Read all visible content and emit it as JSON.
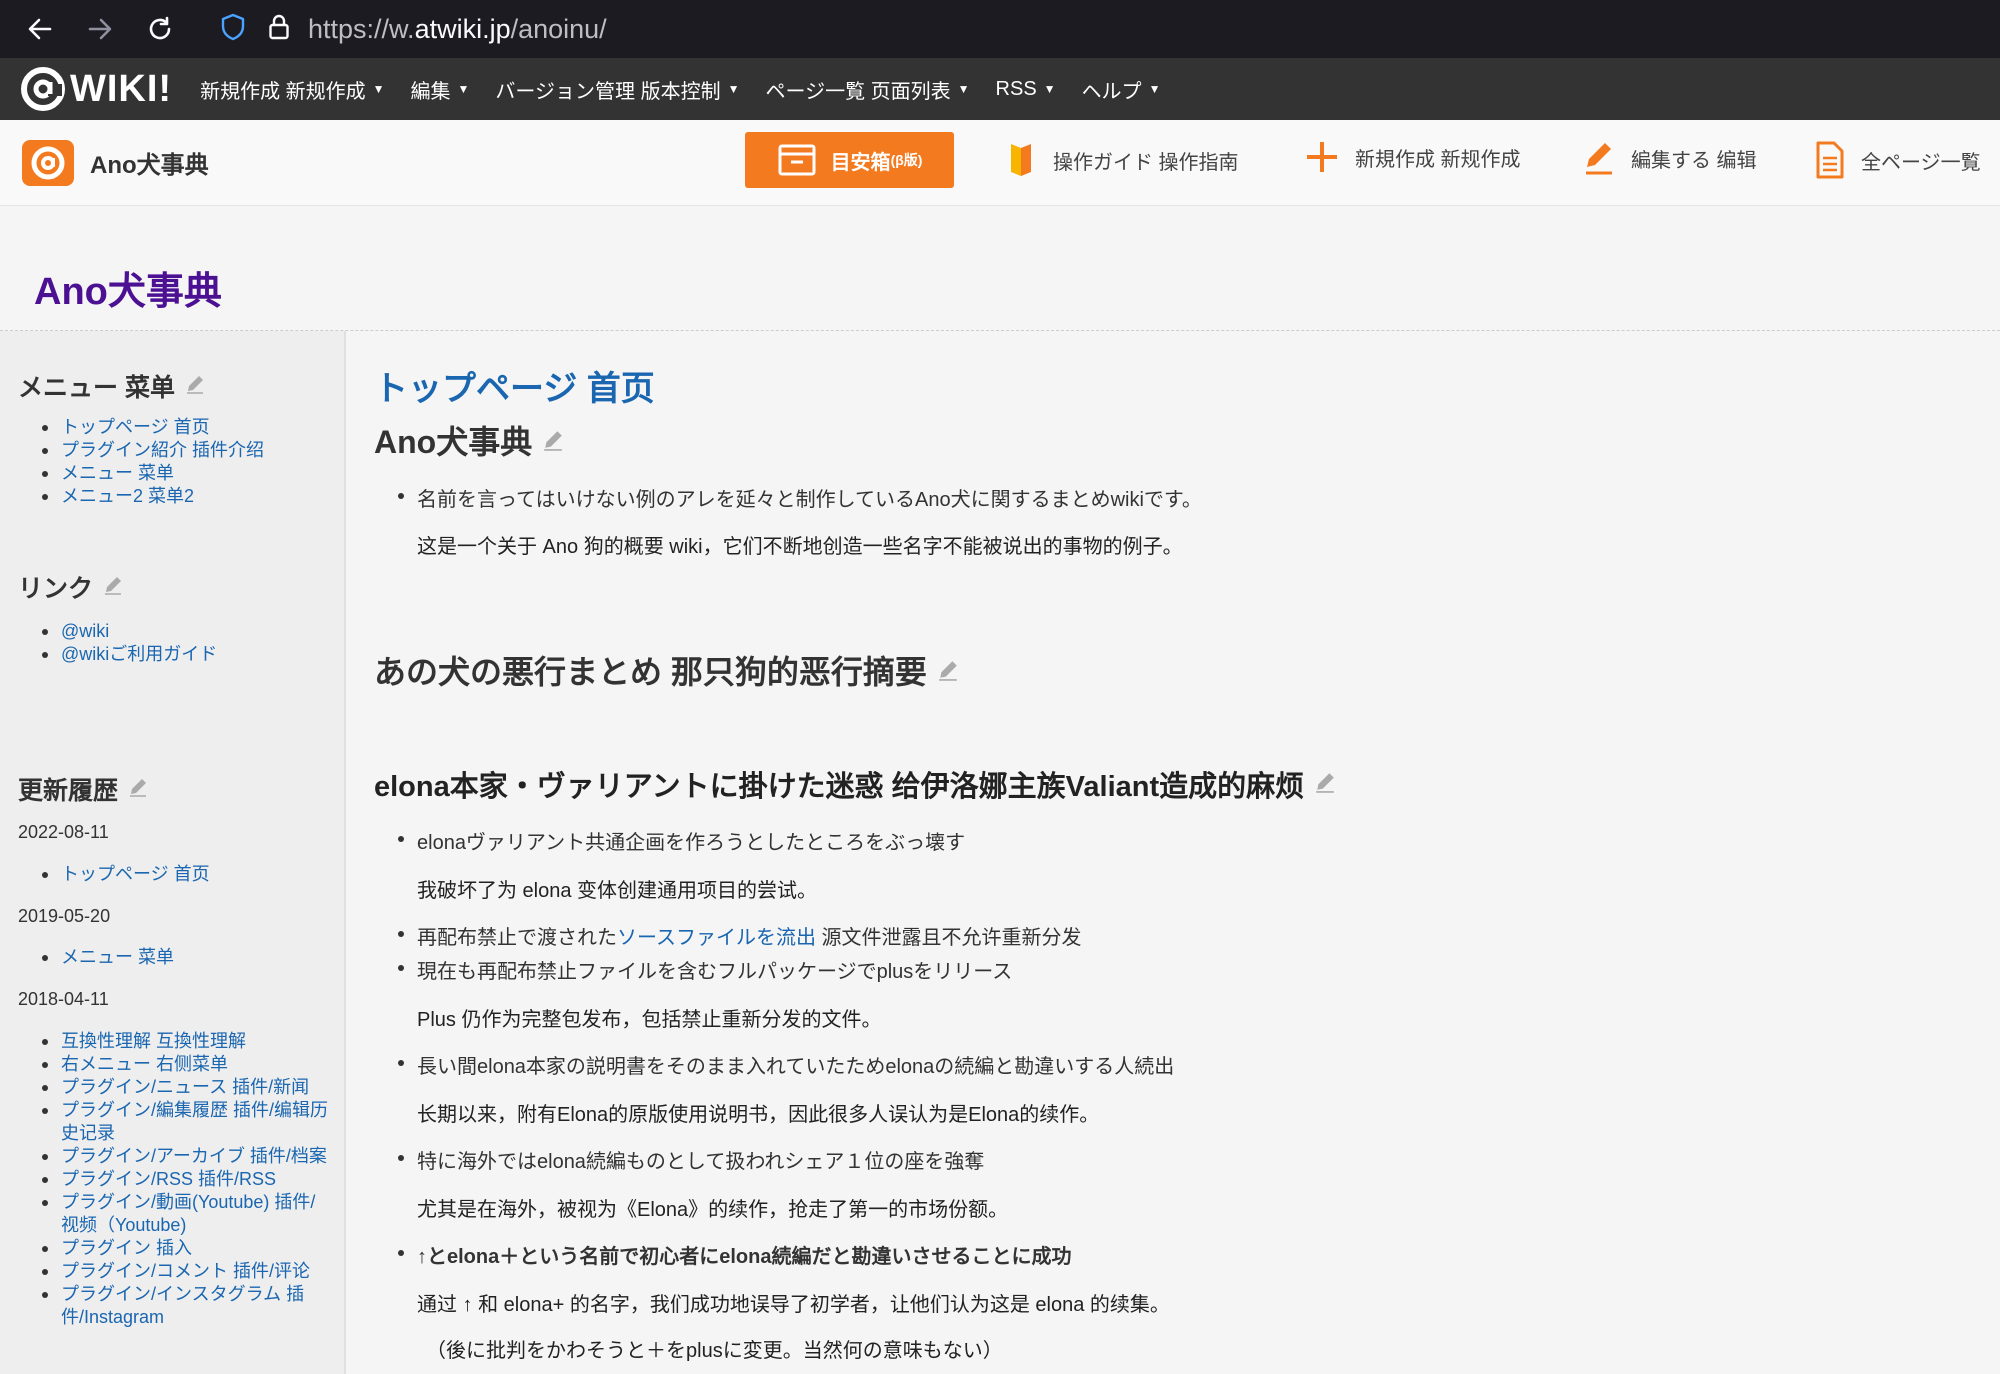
{
  "browser": {
    "url_prefix": "https://w.",
    "url_domain": "atwiki.jp",
    "url_path": "/anoinu/"
  },
  "menubar": {
    "logo": "WIKI!",
    "items": [
      {
        "label": "新規作成 新规作成"
      },
      {
        "label": "編集"
      },
      {
        "label": "バージョン管理 版本控制"
      },
      {
        "label": "ページ一覧 页面列表"
      },
      {
        "label": "RSS"
      },
      {
        "label": "ヘルプ"
      }
    ]
  },
  "header": {
    "site_name": "Ano犬事典",
    "promo_label": "目安箱",
    "promo_small": "(β版)",
    "links": [
      {
        "label": "操作ガイド 操作指南",
        "icon": "guide-icon"
      },
      {
        "label": "新規作成 新规作成",
        "icon": "plus-icon"
      },
      {
        "label": "編集する 编辑",
        "icon": "pencil-icon"
      },
      {
        "label": "全ページ一覧",
        "icon": "page-list-icon"
      }
    ]
  },
  "wiki_title": "Ano犬事典",
  "sidebar": {
    "menu_title": "メニュー 菜单",
    "menu_items": [
      "トップページ 首页",
      "プラグイン紹介 插件介绍",
      "メニュー 菜单",
      "メニュー2 菜单2"
    ],
    "links_title": "リンク",
    "link_items": [
      "@wiki",
      "@wikiご利用ガイド"
    ],
    "history_title": "更新履歴",
    "history": [
      {
        "date": "2022-08-11",
        "items": [
          "トップページ 首页"
        ]
      },
      {
        "date": "2019-05-20",
        "items": [
          "メニュー 菜单"
        ]
      },
      {
        "date": "2018-04-11",
        "items": [
          "互換性理解 互換性理解",
          "右メニュー 右侧菜单",
          "プラグイン/ニュース 插件/新闻",
          "プラグイン/編集履歴 插件/编辑历史记录",
          "プラグイン/アーカイブ 插件/档案",
          "プラグイン/RSS 插件/RSS",
          "プラグイン/動画(Youtube) 插件/视频（Youtube)",
          "プラグイン 插入",
          "プラグイン/コメント 插件/评论",
          "プラグイン/インスタグラム 插件/Instagram"
        ]
      }
    ]
  },
  "main": {
    "page_title": "トップページ 首页",
    "h_ano": "Ano犬事典",
    "intro_bullet": "名前を言ってはいけない例のアレを延々と制作しているAno犬に関するまとめwikiです。",
    "intro_cn": "这是一个关于 Ano 狗的概要 wiki，它们不断地创造一些名字不能被说出的事物的例子。",
    "h_summary": "あの犬の悪行まとめ 那只狗的恶行摘要",
    "h_elona": "elona本家・ヴァリアントに掛けた迷惑 给伊洛娜主族Valiant造成的麻烦",
    "b1": "elonaヴァリアント共通企画を作ろうとしたところをぶっ壊す",
    "b1_cn": "我破坏了为 elona 变体创建通用项目的尝试。",
    "b2_pre": "再配布禁止で渡された",
    "b2_link": "ソースファイルを流出",
    "b2_post": " 源文件泄露且不允许重新分发",
    "b3": "現在も再配布禁止ファイルを含むフルパッケージでplusをリリース",
    "b3_cn": "Plus 仍作为完整包发布，包括禁止重新分发的文件。",
    "b4": "長い間elona本家の説明書をそのまま入れていたためelonaの続編と勘違いする人続出",
    "b4_cn": "长期以来，附有Elona的原版使用说明书，因此很多人误认为是Elona的续作。",
    "b5": "特に海外ではelona続編ものとして扱われシェア１位の座を強奪",
    "b5_cn": "尤其是在海外，被视为《Elona》的续作，抢走了第一的市场份额。",
    "b6": "↑とelona＋という名前で初心者にelona続編だと勘違いさせることに成功",
    "b6_cn": "通过 ↑ 和 elona+ 的名字，我们成功地误导了初学者，让他们认为这是 elona 的续集。",
    "b6_note": "（後に批判をかわそうと＋をplusに変更。当然何の意味もない）"
  },
  "colors": {
    "menubar_bg": "#333333",
    "accent_orange": "#f47a20",
    "title_purple": "#4c1193",
    "link_blue": "#1a66b0"
  }
}
